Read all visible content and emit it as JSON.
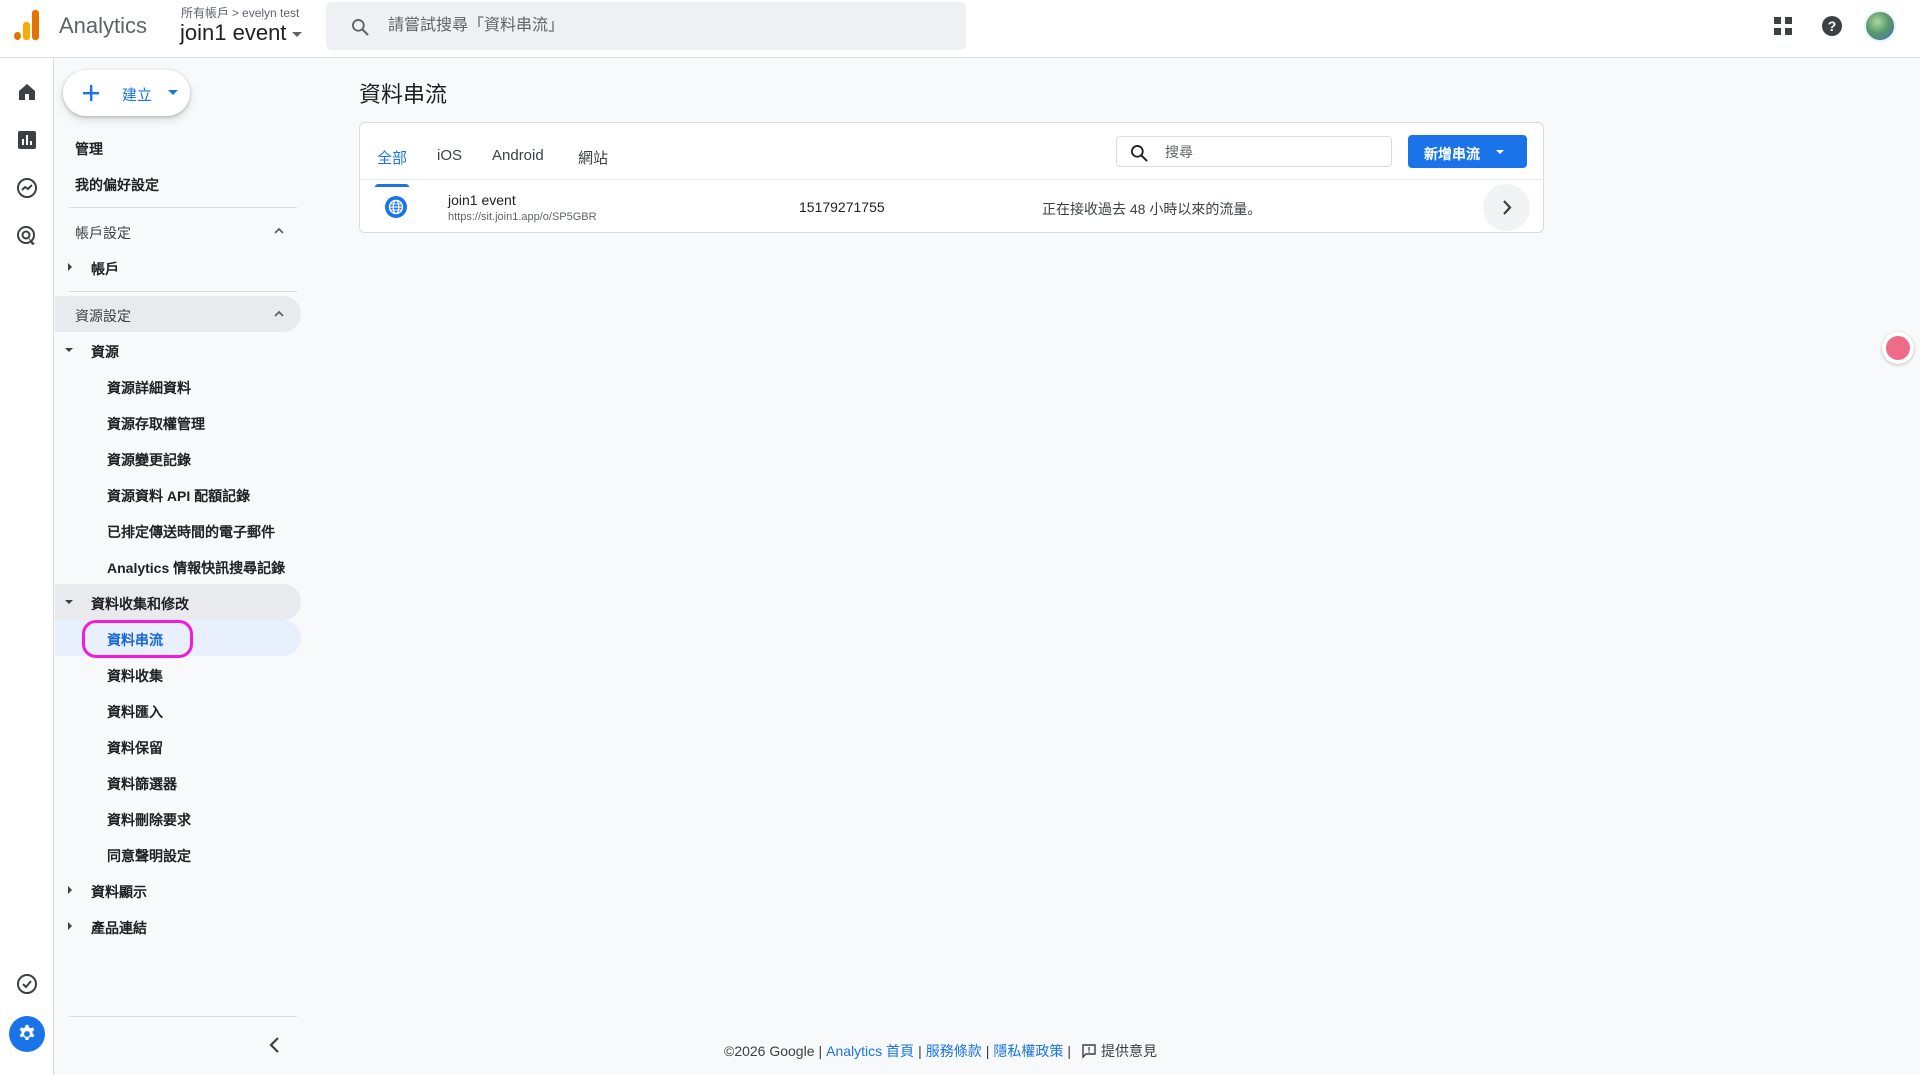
{
  "header": {
    "product_name": "Analytics",
    "breadcrumb_root": "所有帳戶",
    "breadcrumb_sep": ">",
    "breadcrumb_account": "evelyn test",
    "property_name": "join1 event",
    "search_placeholder": "請嘗試搜尋「資料串流」"
  },
  "icons": {
    "apps": "apps-grid-icon",
    "help": "help-icon",
    "rail": [
      "home-icon",
      "reports-icon",
      "explore-icon",
      "advertising-icon",
      "check-circle-icon",
      "settings-gear-icon"
    ]
  },
  "nav": {
    "create_label": "建立",
    "admin_label": "管理",
    "preferences_label": "我的偏好設定",
    "account_settings_label": "帳戶設定",
    "account_label": "帳戶",
    "property_settings_label": "資源設定",
    "property_label": "資源",
    "property_items": [
      "資源詳細資料",
      "資源存取權管理",
      "資源變更記錄",
      "資源資料 API 配額記錄",
      "已排定傳送時間的電子郵件",
      "Analytics 情報快訊搜尋記錄"
    ],
    "data_collection_group_label": "資料收集和修改",
    "data_collection_items": [
      "資料串流",
      "資料收集",
      "資料匯入",
      "資料保留",
      "資料篩選器",
      "資料刪除要求",
      "同意聲明設定"
    ],
    "data_display_label": "資料顯示",
    "product_links_label": "產品連結"
  },
  "main": {
    "title": "資料串流",
    "tabs": [
      "全部",
      "iOS",
      "Android",
      "網站"
    ],
    "active_tab": "全部",
    "search_placeholder": "搜尋",
    "add_stream_label": "新增串流",
    "streams": [
      {
        "name": "join1 event",
        "url": "https://sit.join1.app/o/SP5GBR",
        "stream_id": "15179271755",
        "status": "正在接收過去 48 小時以來的流量。"
      }
    ]
  },
  "footer": {
    "copyright": "©2026 Google",
    "separator": "|",
    "analytics_home": "Analytics 首頁",
    "terms": "服務條款",
    "privacy": "隱私權政策",
    "feedback": "提供意見"
  },
  "colors": {
    "accent": "#1a73e8",
    "highlight_ring": "#f21bdd",
    "logo_orange": "#e37400",
    "logo_yellow": "#f9ab00"
  }
}
